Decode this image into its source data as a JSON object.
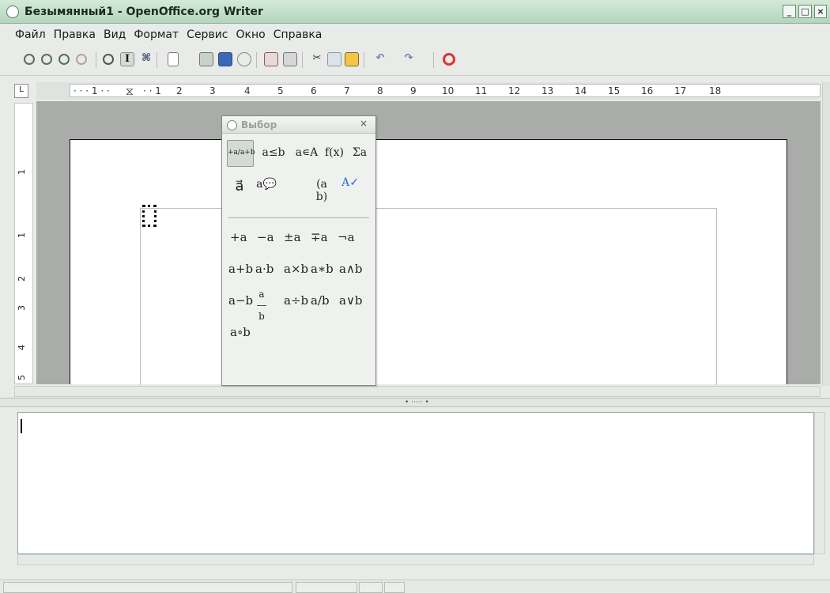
{
  "window": {
    "title": "Безымянный1 - OpenOffice.org Writer",
    "min_label": "_",
    "max_label": "□",
    "close_label": "×"
  },
  "menubar": [
    "Файл",
    "Правка",
    "Вид",
    "Формат",
    "Сервис",
    "Окно",
    "Справка"
  ],
  "toolbar": {
    "icons": [
      "zoom-in-icon",
      "zoom-out-icon",
      "zoom-100-icon",
      "show-all-icon",
      "update-icon",
      "formula-cursor-icon",
      "symbols-icon",
      "new-icon",
      "open-icon",
      "save-icon",
      "email-icon",
      "export-pdf-icon",
      "print-icon",
      "cut-icon",
      "copy-icon",
      "paste-icon",
      "undo-icon",
      "redo-icon",
      "help-icon"
    ]
  },
  "ruler": {
    "corner": "L",
    "labels": [
      "1",
      "1",
      "2",
      "3",
      "4",
      "5",
      "6",
      "7",
      "8",
      "9",
      "10",
      "11",
      "12",
      "13",
      "14",
      "15",
      "16",
      "17",
      "18"
    ],
    "vertical": [
      "1",
      "1",
      "2",
      "3",
      "4",
      "5"
    ]
  },
  "selection_panel": {
    "title": "Выбор",
    "close": "×",
    "categories": [
      "+a/a+b",
      "a≤b",
      "a∊A",
      "f(x)",
      "Σa",
      "a⃗",
      "a💬",
      "(a b)",
      "A✓"
    ],
    "symbols": [
      [
        "+a",
        "−a",
        "±a",
        "∓a",
        "¬a"
      ],
      [
        "a+b",
        "a·b",
        "a×b",
        "a∗b",
        "a∧b"
      ],
      [
        "a−b",
        "a/b",
        "a÷b",
        "a/b",
        "a∨b"
      ],
      [
        "a∘b"
      ]
    ]
  },
  "colors": {
    "title_bg": "#c6e4ce",
    "page_bg": "#ffffff",
    "doc_bg": "#a9aca9"
  }
}
